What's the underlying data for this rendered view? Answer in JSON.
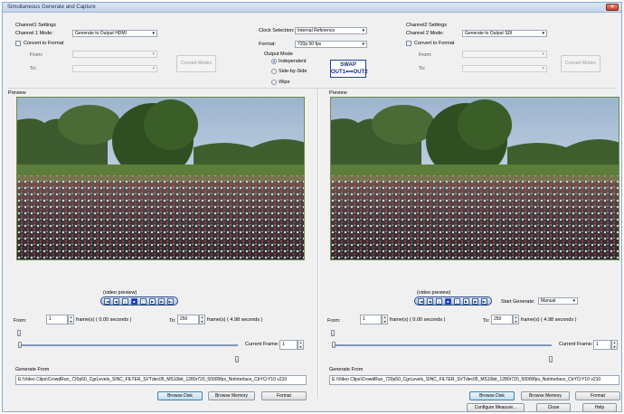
{
  "window": {
    "title": "Simultaneous Generate and Capture",
    "close_glyph": "✕"
  },
  "channel1": {
    "settings_label": "Channel1 Settings",
    "mode_label": "Channel 1 Mode:",
    "mode_value": "Generate to Output HDMI",
    "convert_label": "Convert to Format",
    "from_label": "From:",
    "to_label": "To:",
    "convert_modes_label": "Convert Modes",
    "preview_label": "Preview",
    "video_preview_label": "(video preview)",
    "from_frame_label": "From:",
    "from_frame_value": "1",
    "from_frame_unit": "frame(s)",
    "from_seconds": "( 0.00 seconds )",
    "to_frame_label": "To:",
    "to_frame_value": "250",
    "to_frame_unit": "frame(s)",
    "to_seconds": "( 4.98 seconds )",
    "current_frame_label": "Current Frame:",
    "current_frame_value": "1",
    "generate_from_label": "Generate From",
    "path_value": "E:\\Video Clips\\CrowdRun_720p50_CgrLevels_SINC_FILTER_SVTdec05_MS10bit_1280r720_50000fps_NoInterlace_CbYCrY10 v210",
    "browse_disk_label": "Browse Disk",
    "browse_memory_label": "Browse Memory",
    "format_label": "Format"
  },
  "center": {
    "clock_label": "Clock Selection:",
    "clock_value": "Internal Reference",
    "format_label": "Format:",
    "format_value": "720p 50 fps",
    "output_mode_label": "Output Mode",
    "modes": [
      "Independent",
      "Side-by-Side",
      "Wipe"
    ],
    "swap_label_1": "SWAP",
    "swap_label_2": "OUT1⟺OUT2"
  },
  "channel2": {
    "settings_label": "Channel2 Settings",
    "mode_label": "Channel 2 Mode:",
    "mode_value": "Generate to Output SDI",
    "convert_label": "Convert to Format",
    "from_label": "From:",
    "to_label": "To:",
    "convert_modes_label": "Convert Modes",
    "preview_label": "Preview",
    "video_preview_label": "(video preview)",
    "start_generate_label": "Start Generate:",
    "start_generate_value": "Manual",
    "from_frame_label": "From:",
    "from_frame_value": "1",
    "from_frame_unit": "frame(s)",
    "from_seconds": "( 0.00 seconds )",
    "to_frame_label": "To:",
    "to_frame_value": "250",
    "to_frame_unit": "frame(s)",
    "to_seconds": "( 4.98 seconds )",
    "current_frame_label": "Current Frame:",
    "current_frame_value": "1",
    "generate_from_label": "Generate From",
    "path_value": "E:\\Video Clips\\CrowdRun_720p50_CgrLevels_SINC_FILTER_SVTdec05_MS10bit_1280r720_50000fps_NoInterlace_CbYCrY10 v210",
    "browse_disk_label": "Browse Disk",
    "browse_memory_label": "Browse Memory",
    "format_label": "Format"
  },
  "footer": {
    "configure_label": "Configure Measure...",
    "close_label": "Close",
    "help_label": "Help"
  },
  "transport_glyphs": [
    "|◀",
    "◀|",
    "||",
    "■",
    "▢",
    "▶",
    "|▶",
    "▶|"
  ],
  "colors": {
    "accent": "#1b2fd1",
    "title_bar": "#c3d4ea",
    "preview_border": "#6c8d4e"
  }
}
